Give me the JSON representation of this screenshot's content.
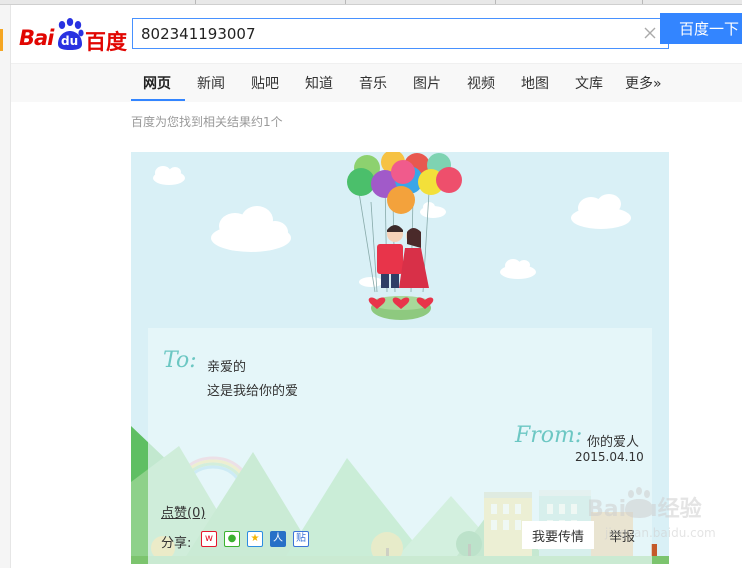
{
  "logo": {
    "bai": "Bai",
    "du": "du",
    "cn": "百度",
    "brand_color": "#e10602"
  },
  "search": {
    "value": "802341193007",
    "button_label": "百度一下"
  },
  "nav": {
    "items": [
      {
        "label": "网页",
        "active": true
      },
      {
        "label": "新闻"
      },
      {
        "label": "贴吧"
      },
      {
        "label": "知道"
      },
      {
        "label": "音乐"
      },
      {
        "label": "图片"
      },
      {
        "label": "视频"
      },
      {
        "label": "地图"
      },
      {
        "label": "文库"
      },
      {
        "label": "更多»"
      }
    ],
    "accent": "#3385ff"
  },
  "results": {
    "count_text": "百度为您找到相关结果约1个"
  },
  "card": {
    "to_word": "To:",
    "to_name": "亲爱的",
    "message": "这是我给你的爱",
    "from_word": "From:",
    "from_name": "你的爱人",
    "date": "2015.04.10",
    "likes": "点赞(0)",
    "share_label": "分享:",
    "share_icons": [
      "weibo-icon",
      "wechat-icon",
      "qzone-icon",
      "renren-icon",
      "tieba-icon"
    ],
    "send_button": "我要传情",
    "report_button": "举报",
    "sky_color": "#d9f0f6"
  },
  "watermark": {
    "text": "Baidu经验",
    "url": "jingyan.baidu.com"
  }
}
